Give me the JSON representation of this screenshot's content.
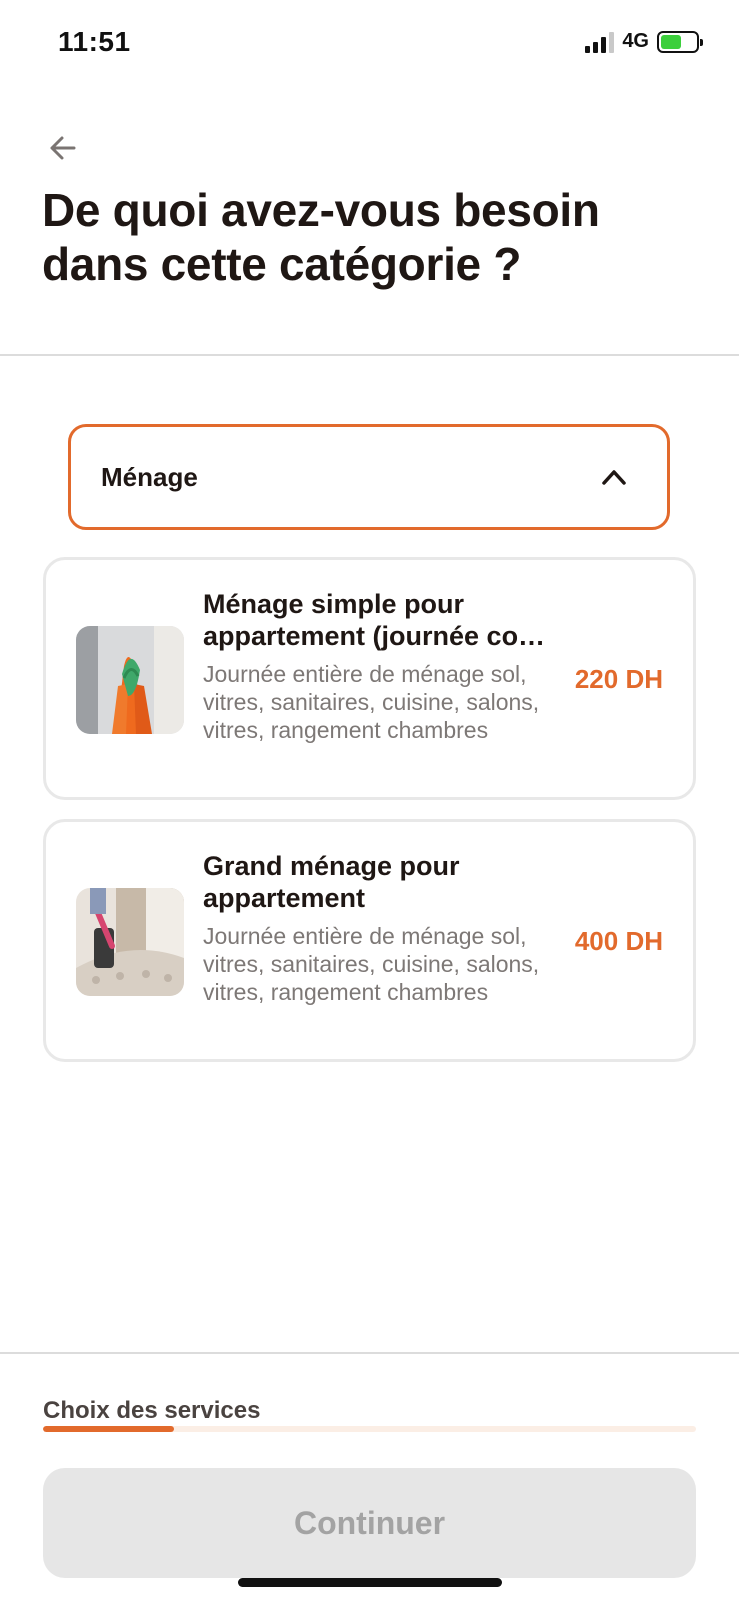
{
  "status_bar": {
    "time": "11:51",
    "network": "4G",
    "battery_level": 0.6
  },
  "header": {
    "back_icon": "arrow-left-icon",
    "title": "De quoi avez-vous besoin dans cette catégorie ?"
  },
  "category_select": {
    "selected": "Ménage",
    "expanded": true,
    "icon": "chevron-up-icon"
  },
  "services": [
    {
      "title": "Ménage simple pour appartement (journée co…",
      "description": "Journée entière de ménage sol, vitres, sanitaires, cuisine, salons, vitres, rangement chambres",
      "price": "220 DH",
      "image": "cleaning-gloves-photo"
    },
    {
      "title": "Grand ménage pour appartement",
      "description": "Journée entière de ménage sol, vitres, sanitaires, cuisine, salons, vitres, rangement chambres",
      "price": "400 DH",
      "image": "sofa-vacuum-photo"
    }
  ],
  "progress": {
    "label": "Choix des services",
    "value_fraction": 0.2
  },
  "footer": {
    "continue_label": "Continuer",
    "continue_enabled": false
  },
  "colors": {
    "accent": "#e26a2c",
    "text": "#1f1714",
    "muted": "#7d7876",
    "disabled_bg": "#e6e6e6",
    "disabled_text": "#a3a3a3"
  }
}
